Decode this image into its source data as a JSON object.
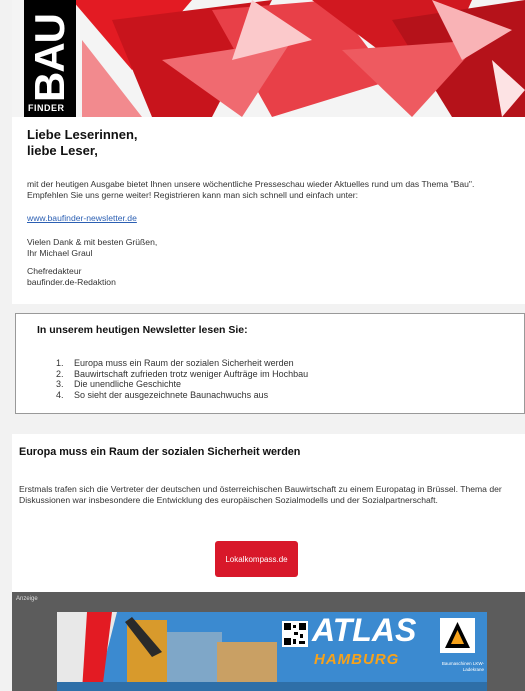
{
  "header": {
    "logo_main": "BAU",
    "logo_sub": "FINDER",
    "accent": "#e31b23"
  },
  "intro": {
    "greeting_line1": "Liebe Leserinnen,",
    "greeting_line2": "liebe Leser,",
    "body": "mit der heutigen Ausgabe bietet Ihnen unsere wöchentliche Presseschau wieder Aktuelles rund um das Thema \"Bau\". Empfehlen Sie uns gerne weiter! Registrieren kann man sich schnell und einfach unter:",
    "link": "www.baufinder-newsletter.de",
    "thanks_line1": "Vielen Dank & mit besten Grüßen,",
    "thanks_line2": "Ihr Michael Graul",
    "sign_line1": "Chefredakteur",
    "sign_line2": "baufinder.de-Redaktion"
  },
  "toc": {
    "title": "In unserem heutigen Newsletter lesen Sie:",
    "items": [
      {
        "num": "1.",
        "text": "Europa muss ein Raum der sozialen Sicherheit werden"
      },
      {
        "num": "2.",
        "text": "Bauwirtschaft zufrieden trotz weniger Aufträge im Hochbau"
      },
      {
        "num": "3.",
        "text": "Die unendliche Geschichte"
      },
      {
        "num": "4.",
        "text": "So sieht der ausgezeichnete Baunachwuchs aus"
      }
    ]
  },
  "article": {
    "title": "Europa muss ein Raum der sozialen Sicherheit werden",
    "body": "Erstmals trafen sich die Vertreter der deutschen und österreichischen Bauwirtschaft zu einem Europatag in Brüssel. Thema der Diskussionen war insbesondere die Entwicklung des europäischen Sozialmodells und der Sozialpartnerschaft.",
    "source_button": "Lokalkompass.de",
    "button_color": "#d8182a"
  },
  "ad": {
    "label": "Anzeige",
    "brand": "ATLAS",
    "city": "HAMBURG",
    "small_text": "Baumaschinen LKW-Ladekrane"
  }
}
